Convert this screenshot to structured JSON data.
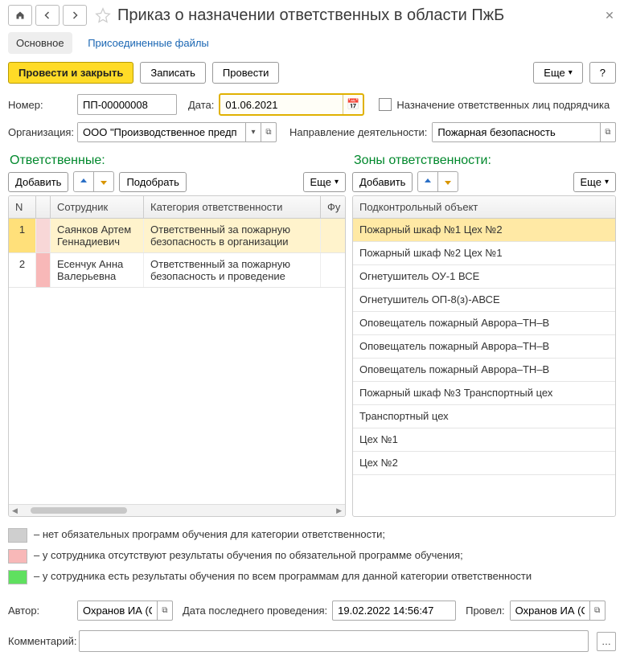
{
  "header": {
    "title": "Приказ о назначении ответственных в области ПжБ"
  },
  "tabs": {
    "main": "Основное",
    "attachments": "Присоединенные файлы"
  },
  "actions": {
    "post_close": "Провести и закрыть",
    "write": "Записать",
    "post": "Провести",
    "more": "Еще",
    "help": "?"
  },
  "fields": {
    "number_label": "Номер:",
    "number_value": "ПП-00000008",
    "date_label": "Дата:",
    "date_value": "01.06.2021",
    "contractor_checkbox_label": "Назначение ответственных лиц подрядчика",
    "org_label": "Организация:",
    "org_value": "ООО \"Производственное предп",
    "activity_label": "Направление деятельности:",
    "activity_value": "Пожарная безопасность"
  },
  "left_panel": {
    "title": "Ответственные:",
    "add": "Добавить",
    "pick": "Подобрать",
    "more": "Еще",
    "columns": {
      "n": "N",
      "emp": "Сотрудник",
      "cat": "Категория ответственности",
      "fu": "Фу"
    },
    "rows": [
      {
        "n": "1",
        "flag_color": "#f8d7d7",
        "emp": "Саянков Артем Геннадиевич",
        "cat": "Ответственный за пожарную безопасность в организации",
        "selected": true
      },
      {
        "n": "2",
        "flag_color": "#f8b8b8",
        "emp": "Есенчук Анна Валерьевна",
        "cat": "Ответственный за пожарную безопасность и проведение",
        "selected": false
      }
    ]
  },
  "right_panel": {
    "title": "Зоны ответственности:",
    "add": "Добавить",
    "more": "Еще",
    "column": "Подконтрольный объект",
    "rows": [
      "Пожарный шкаф №1 Цех №2",
      "Пожарный шкаф №2 Цех №1",
      "Огнетушитель ОУ-1 ВСЕ",
      "Огнетушитель ОП-8(з)-АВСЕ",
      "Оповещатель пожарный Аврора–ТН–В",
      "Оповещатель пожарный Аврора–ТН–В",
      "Оповещатель пожарный Аврора–ТН–В",
      "Пожарный шкаф №3 Транспортный цех",
      "Транспортный цех",
      "Цех №1",
      "Цех №2"
    ],
    "selected_index": 0
  },
  "legend": {
    "items": [
      {
        "color": "#cfcfcf",
        "text": "– нет обязательных программ обучения для категории ответственности;"
      },
      {
        "color": "#f8b8b8",
        "text": "– у сотрудника отсутствуют результаты обучения по обязательной программе обучения;"
      },
      {
        "color": "#5fe05f",
        "text": "– у сотрудника есть результаты обучения по всем программам для данной категории ответственности"
      }
    ]
  },
  "footer": {
    "author_label": "Автор:",
    "author_value": "Охранов ИА (С",
    "last_post_label": "Дата последнего проведения:",
    "last_post_value": "19.02.2022 14:56:47",
    "posted_by_label": "Провел:",
    "posted_by_value": "Охранов ИА (С",
    "comment_label": "Комментарий:",
    "comment_value": ""
  }
}
